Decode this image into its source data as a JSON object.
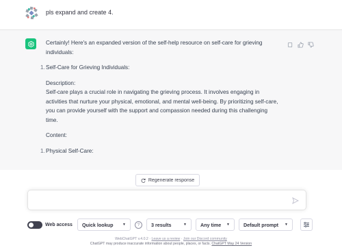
{
  "user_message": {
    "avatar_icon": "user-avatar-icon",
    "text": "pls expand and create 4."
  },
  "assistant_message": {
    "avatar_icon": "openai-logo-icon",
    "accent_color": "#19c37d",
    "intro": "Certainly! Here's an expanded version of the self-help resource on self-care for grieving individuals:",
    "item1_number": "1.",
    "item1_title": "Self-Care for Grieving Individuals:",
    "description_label": "Description:",
    "description_text": "Self-care plays a crucial role in navigating the grieving process. It involves engaging in activities that nurture your physical, emotional, and mental well-being. By prioritizing self-care, you can provide yourself with the support and compassion needed during this challenging time.",
    "content_label": "Content:",
    "sub1_number": "1.",
    "sub1_title": "Physical Self-Care:",
    "actions": [
      "copy-icon",
      "thumbs-up-icon",
      "thumbs-down-icon"
    ]
  },
  "regenerate": {
    "icon": "refresh-icon",
    "label": "Regenerate response"
  },
  "composer": {
    "placeholder": "",
    "send_icon": "send-icon"
  },
  "toolbar": {
    "web_access_label": "Web access",
    "mode": "Quick lookup",
    "help_icon_text": "?",
    "results": "3 results",
    "time": "Any time",
    "prompt": "Default prompt",
    "settings_icon": "sliders-icon"
  },
  "footer": {
    "version": "WebChatGPT v.4.0.2",
    "sep1": " · ",
    "review_link": "Leave us a review",
    "sep2": " · ",
    "discord_link": "Join our Discord community",
    "disclaimer": "ChatGPT may produce inaccurate information about people, places, or facts.",
    "version_link": "ChatGPT May 24 Version"
  }
}
